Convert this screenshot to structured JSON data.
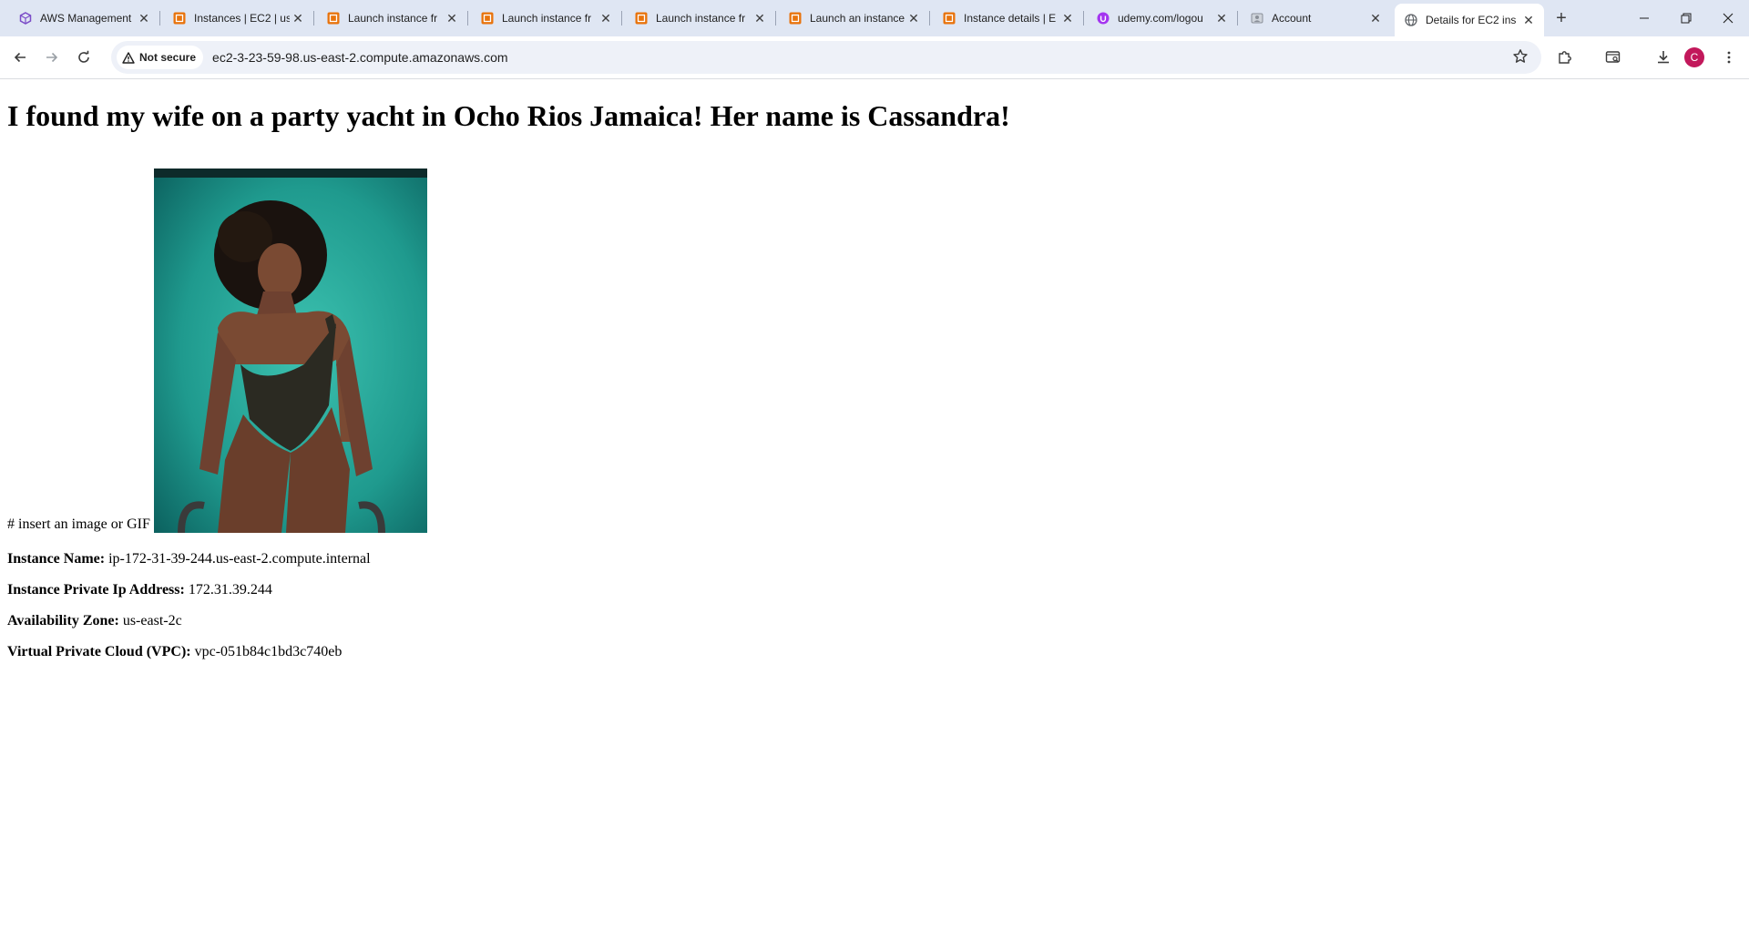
{
  "browser": {
    "tabs": [
      {
        "title": "AWS Management",
        "favicon": "aws-cube-icon",
        "active": false
      },
      {
        "title": "Instances | EC2 | us",
        "favicon": "ec2-icon",
        "active": false
      },
      {
        "title": "Launch instance fr",
        "favicon": "ec2-icon",
        "active": false
      },
      {
        "title": "Launch instance fr",
        "favicon": "ec2-icon",
        "active": false
      },
      {
        "title": "Launch instance fr",
        "favicon": "ec2-icon",
        "active": false
      },
      {
        "title": "Launch an instance",
        "favicon": "ec2-icon",
        "active": false
      },
      {
        "title": "Instance details | E",
        "favicon": "ec2-icon",
        "active": false
      },
      {
        "title": "udemy.com/logou",
        "favicon": "udemy-icon",
        "active": false
      },
      {
        "title": "Account",
        "favicon": "account-icon",
        "active": false
      },
      {
        "title": "Details for EC2 ins",
        "favicon": "globe-icon",
        "active": true
      }
    ],
    "security_label": "Not secure",
    "url": "ec2-3-23-59-98.us-east-2.compute.amazonaws.com",
    "profile_initial": "C",
    "colors": {
      "tabstrip": "#dfe6f3",
      "ec2_orange": "#e8730c",
      "udemy_purple": "#a435f0",
      "avatar": "#c2185b"
    }
  },
  "page": {
    "headline": "I found my wife on a party yacht in Ocho Rios Jamaica! Her name is Cassandra!",
    "image_caption": "# insert an image or GIF",
    "details": [
      {
        "label": "Instance Name:",
        "value": "ip-172-31-39-244.us-east-2.compute.internal"
      },
      {
        "label": "Instance Private Ip Address:",
        "value": "172.31.39.244"
      },
      {
        "label": "Availability Zone:",
        "value": "us-east-2c"
      },
      {
        "label": "Virtual Private Cloud (VPC):",
        "value": "vpc-051b84c1bd3c740eb"
      }
    ]
  }
}
